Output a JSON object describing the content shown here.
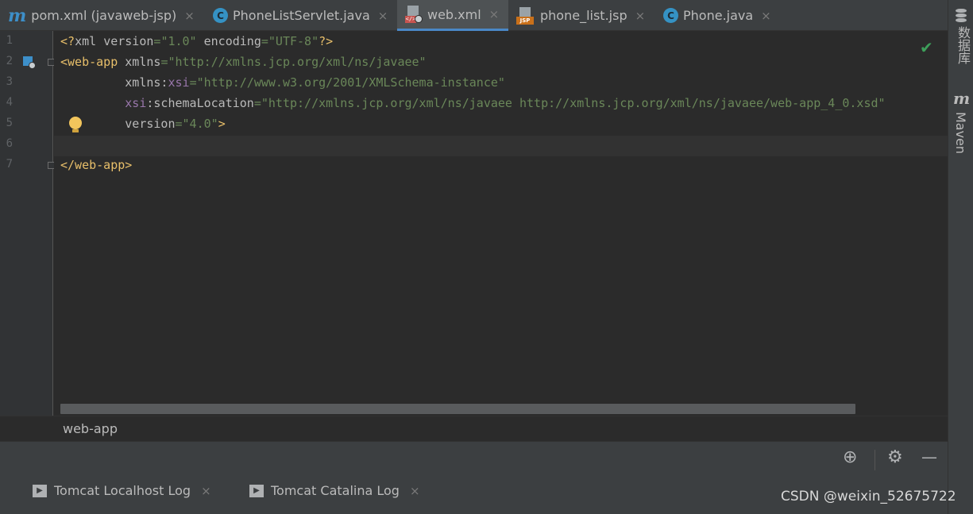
{
  "tabs": [
    {
      "label": "pom.xml (javaweb-jsp)",
      "icon": "maven-icon",
      "active": false
    },
    {
      "label": "PhoneListServlet.java",
      "icon": "java-class-icon",
      "active": false
    },
    {
      "label": "web.xml",
      "icon": "xml-file-icon",
      "active": true
    },
    {
      "label": "phone_list.jsp",
      "icon": "jsp-file-icon",
      "active": false
    },
    {
      "label": "Phone.java",
      "icon": "java-class-icon",
      "active": false
    }
  ],
  "tab_close_glyph": "×",
  "icon_letters": {
    "maven": "m",
    "class": "C",
    "xml_tag": "</>",
    "jsp_tag": "JSP"
  },
  "line_numbers": [
    "1",
    "2",
    "3",
    "4",
    "5",
    "6",
    "7"
  ],
  "code": {
    "l1_open": "<?",
    "l1_name": "xml ",
    "l1_attr1": "version",
    "l1_eq1": "=",
    "l1_val1": "\"1.0\"",
    "l1_sp": " ",
    "l1_attr2": "encoding",
    "l1_eq2": "=",
    "l1_val2": "\"UTF-8\"",
    "l1_close": "?>",
    "l2_tag": "<web-app",
    "l2_sp": " ",
    "l2_attr": "xmlns",
    "l2_eq": "=",
    "l2_val": "\"http://xmlns.jcp.org/xml/ns/javaee\"",
    "l3_indent": "         ",
    "l3_attr": "xmlns:",
    "l3_ns": "xsi",
    "l3_eq": "=",
    "l3_val": "\"http://www.w3.org/2001/XMLSchema-instance\"",
    "l4_indent": "         ",
    "l4_ns": "xsi",
    "l4_attr": ":schemaLocation",
    "l4_eq": "=",
    "l4_val": "\"http://xmlns.jcp.org/xml/ns/javaee http://xmlns.jcp.org/xml/ns/javaee/web-app_4_0.xsd\"",
    "l5_indent": "         ",
    "l5_attr": "version",
    "l5_eq": "=",
    "l5_val": "\"4.0\"",
    "l5_close": ">",
    "l7_tag": "</web-app>"
  },
  "inspection_glyph": "✔",
  "breadcrumb": "web-app",
  "right_strip": {
    "database_label": "数据库",
    "maven_label": "Maven",
    "maven_letter": "m"
  },
  "bottom_tools": {
    "target_glyph": "⊕",
    "gear_glyph": "⚙",
    "minimize_glyph": "—"
  },
  "log_tabs": [
    {
      "label": "Tomcat Localhost Log"
    },
    {
      "label": "Tomcat Catalina Log"
    }
  ],
  "run_glyph": "▶",
  "watermark": "CSDN @weixin_52675722"
}
